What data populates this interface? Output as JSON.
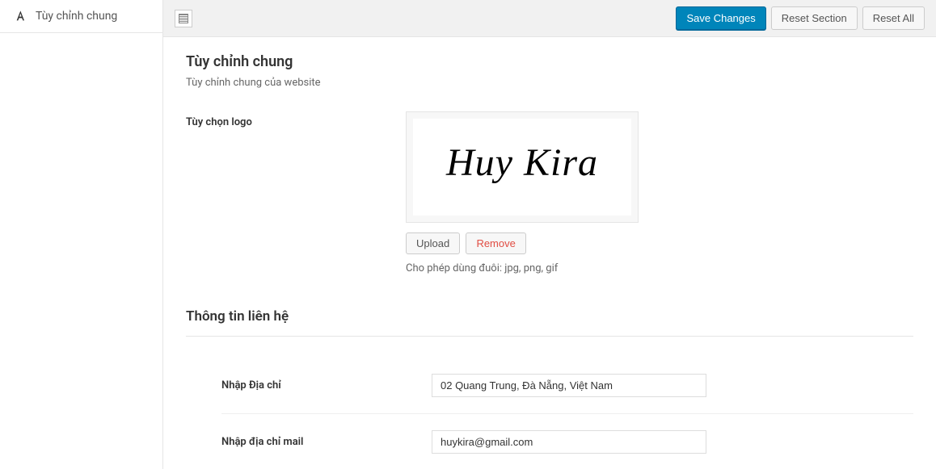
{
  "sidebar": {
    "items": [
      {
        "label": "Tùy chỉnh chung"
      }
    ]
  },
  "topbar": {
    "save_label": "Save Changes",
    "reset_section_label": "Reset Section",
    "reset_all_label": "Reset All"
  },
  "section1": {
    "title": "Tùy chỉnh chung",
    "desc": "Tùy chỉnh chung của website",
    "logo_label": "Tùy chọn logo",
    "logo_text": "Huy Kira",
    "upload_label": "Upload",
    "remove_label": "Remove",
    "helper": "Cho phép dùng đuôi: jpg, png, gif"
  },
  "section2": {
    "title": "Thông tin liên hệ",
    "address_label": "Nhập Địa chỉ",
    "address_value": "02 Quang Trung, Đà Nẵng, Việt Nam",
    "email_label": "Nhập địa chỉ mail",
    "email_value": "huykira@gmail.com"
  }
}
